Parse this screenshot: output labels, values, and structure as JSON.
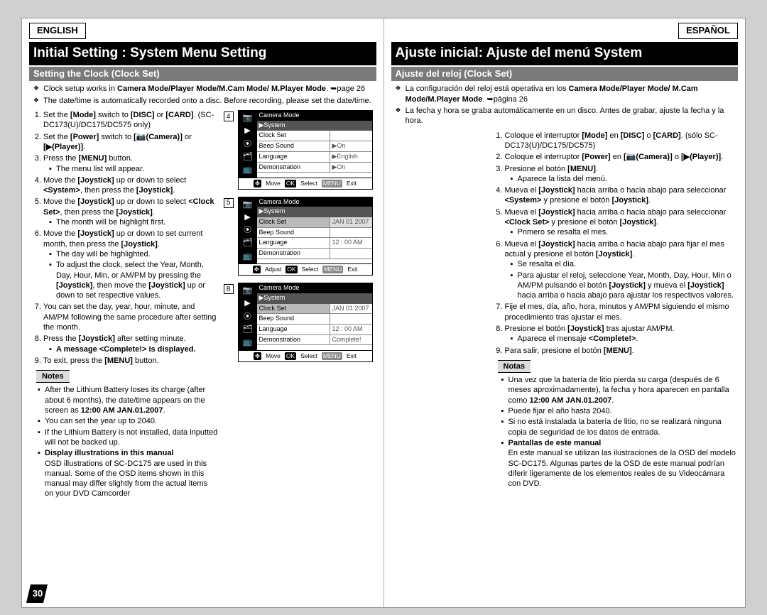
{
  "page_number": "30",
  "left": {
    "lang": "ENGLISH",
    "title": "Initial Setting : System Menu Setting",
    "subtitle": "Setting the Clock (Clock Set)",
    "intro1_pre": "Clock setup works in ",
    "intro1_bold": "Camera Mode/Player Mode/M.Cam Mode/ M.Player Mode",
    "intro1_post": ". ➥page 26",
    "intro2": "The date/time is automatically recorded onto a disc. Before recording, please set the date/time.",
    "s1_a": "Set the ",
    "s1_b": "[Mode]",
    "s1_c": " switch to ",
    "s1_d": "[DISC]",
    "s1_e": " or ",
    "s1_f": "[CARD]",
    "s1_g": ". (SC-DC173(U)/DC175/DC575 only)",
    "s2_a": "Set the ",
    "s2_b": "[Power]",
    "s2_c": " switch to ",
    "s2_d": "[📷(Camera)]",
    "s2_e": " or ",
    "s2_f": "[▶(Player)]",
    "s2_g": ".",
    "s3_a": "Press the ",
    "s3_b": "[MENU]",
    "s3_c": " button.",
    "s3_sub": "The menu list will appear.",
    "s4_a": "Move the ",
    "s4_b": "[Joystick]",
    "s4_c": " up or down to select ",
    "s4_d": "<System>",
    "s4_e": ", then press the ",
    "s4_f": "[Joystick]",
    "s4_g": ".",
    "s5_a": "Move the ",
    "s5_b": "[Joystick]",
    "s5_c": " up or down to select ",
    "s5_d": "<Clock Set>",
    "s5_e": ", then press the ",
    "s5_f": "[Joystick]",
    "s5_g": ".",
    "s5_sub": "The month will be highlight first.",
    "s6_a": "Move the ",
    "s6_b": "[Joystick]",
    "s6_c": " up or down to set current month, then press the ",
    "s6_d": "[Joystick]",
    "s6_e": ".",
    "s6_sub1": "The day will be highlighted.",
    "s6_sub2_a": "To adjust the clock, select the Year, Month, Day, Hour, Min, or AM/PM by pressing the ",
    "s6_sub2_b": "[Joystick]",
    "s6_sub2_c": ", then move the ",
    "s6_sub2_d": "[Joystick]",
    "s6_sub2_e": " up or down to set respective values.",
    "s7": "You can set the day, year, hour, minute, and AM/PM following the same procedure after setting the month.",
    "s8_a": "Press the ",
    "s8_b": "[Joystick]",
    "s8_c": " after setting minute.",
    "s8_sub_a": "A message ",
    "s8_sub_b": "<Complete!>",
    "s8_sub_c": " is displayed.",
    "s9_a": "To exit, press the ",
    "s9_b": "[MENU]",
    "s9_c": " button.",
    "notes_hdr": "Notes",
    "n1_a": "After the Lithium Battery loses its charge (after about 6 months), the date/time appears on the screen as ",
    "n1_b": "12:00 AM JAN.01.2007",
    "n1_c": ".",
    "n2": "You can set the year up to 2040.",
    "n3": "If the Lithium Battery is not installed, data inputted will not be backed up.",
    "n4_b": "Display illustrations in this manual",
    "n4_t": "OSD illustrations of SC-DC175 are used in this manual. Some of the OSD items shown in this manual may differ slightly from the actual items on your DVD Camcorder"
  },
  "right": {
    "lang": "ESPAÑOL",
    "title": "Ajuste inicial: Ajuste del menú System",
    "subtitle": "Ajuste del reloj (Clock Set)",
    "intro1_pre": "La configuración del reloj está operativa en los ",
    "intro1_bold": "Camera Mode/Player Mode/ M.Cam Mode/M.Player Mode",
    "intro1_post": ". ➥página 26",
    "intro2": "La fecha y hora se graba automáticamente en un disco. Antes de grabar, ajuste la fecha y la hora.",
    "s1_a": "Coloque el interruptor ",
    "s1_b": "[Mode]",
    "s1_c": " en ",
    "s1_d": "[DISC]",
    "s1_e": " o ",
    "s1_f": "[CARD]",
    "s1_g": ". (sólo SC-DC173(U)/DC175/DC575)",
    "s2_a": "Coloque el interruptor ",
    "s2_b": "[Power]",
    "s2_c": " en ",
    "s2_d": "[📷(Camera)]",
    "s2_e": " o ",
    "s2_f": "[▶(Player)]",
    "s2_g": ".",
    "s3_a": "Presione el botón ",
    "s3_b": "[MENU]",
    "s3_c": ".",
    "s3_sub": "Aparece la lista del menú.",
    "s4_a": "Mueva el ",
    "s4_b": "[Joystick]",
    "s4_c": " hacia arriba o hacia abajo para seleccionar ",
    "s4_d": "<System>",
    "s4_e": " y presione el botón ",
    "s4_f": "[Joystick]",
    "s4_g": ".",
    "s5_a": "Mueva el ",
    "s5_b": "[Joystick]",
    "s5_c": " hacia arriba o hacia abajo para seleccionar ",
    "s5_d": "<Clock Set>",
    "s5_e": " y presione el botón ",
    "s5_f": "[Joystick]",
    "s5_g": ".",
    "s5_sub": "Primero se resalta el mes.",
    "s6_a": "Mueva el ",
    "s6_b": "[Joystick]",
    "s6_c": " hacia arriba o hacia abajo para fijar el mes actual y presione el botón ",
    "s6_d": "[Joystick]",
    "s6_e": ".",
    "s6_sub1": "Se resalta el día.",
    "s6_sub2_a": "Para ajustar el reloj, seleccione Year, Month, Day, Hour, Min o AM/PM pulsando el botón ",
    "s6_sub2_b": "[Joystick]",
    "s6_sub2_c": " y mueva el ",
    "s6_sub2_d": "[Joystick]",
    "s6_sub2_e": " hacia arriba o hacia abajo para ajustar los respectivos valores.",
    "s7": "Fije el mes, día, año, hora, minutos y AM/PM siguiendo el mismo procedimiento tras ajustar el mes.",
    "s8_a": "Presione el botón ",
    "s8_b": "[Joystick]",
    "s8_c": " tras ajustar AM/PM.",
    "s8_sub_a": "Aparece el mensaje ",
    "s8_sub_b": "<Complete!>",
    "s8_sub_c": ".",
    "s9_a": "Para salir, presione el botón ",
    "s9_b": "[MENU]",
    "s9_c": ".",
    "notes_hdr": "Notas",
    "n1_a": "Una vez que la batería de litio pierda su carga (después de 6 meses aproximadamente), la fecha y hora aparecen en pantalla como ",
    "n1_b": "12:00 AM JAN.01.2007",
    "n1_c": ".",
    "n2": "Puede fijar el año hasta 2040.",
    "n3": "Si no está instalada la batería de litio, no se realizará ninguna copia de seguridad de los datos de entrada.",
    "n4_b": "Pantallas de este manual",
    "n4_t": "En este manual se utilizan las ilustraciones de la OSD del modelo SC-DC175. Algunas partes de la OSD de este manual podrían diferir ligeramente de los elementos reales de su Videocámara con DVD."
  },
  "screens": {
    "num4": "4",
    "num5": "5",
    "num8": "8",
    "mode": "Camera Mode",
    "system": "▶System",
    "clockset": "Clock Set",
    "beep": "Beep Sound",
    "lang": "Language",
    "demo": "Demonstration",
    "on": "▶On",
    "eng": "▶English",
    "date": "JAN  01  2007",
    "time": "12 : 00   AM",
    "complete": "Complete!",
    "move": "Move",
    "adjust": "Adjust",
    "select": "Select",
    "exit": "Exit",
    "ok": "OK",
    "menu": "MENU"
  }
}
